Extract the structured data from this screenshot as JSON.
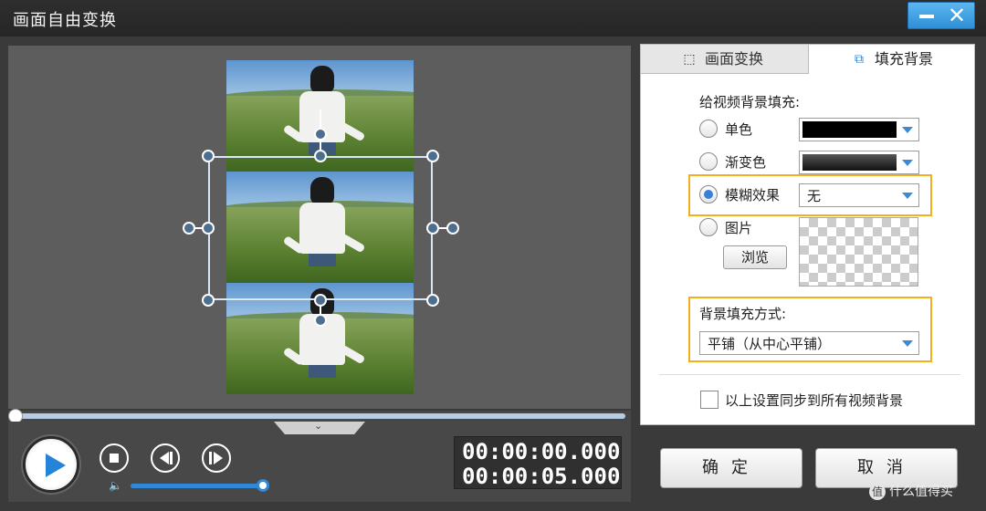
{
  "window": {
    "title": "画面自由变换",
    "minimize_icon": "minimize-icon",
    "close_glyph": "✕"
  },
  "preview": {
    "collapse_glyph": "⌄"
  },
  "playback": {
    "current_time": "00:00:00.000",
    "total_time": "00:00:05.000",
    "progress": 0.0,
    "volume": 1.0
  },
  "tabs": [
    {
      "label": "画面变换",
      "icon": "transform-icon",
      "glyph": "⬚",
      "active": false
    },
    {
      "label": "填充背景",
      "icon": "fill-background-icon",
      "glyph": "⧉",
      "active": true
    }
  ],
  "fill": {
    "section_title": "给视频背景填充:",
    "options": [
      {
        "label": "单色",
        "selected": false
      },
      {
        "label": "渐变色",
        "selected": false
      },
      {
        "label": "模糊效果",
        "selected": true
      },
      {
        "label": "图片",
        "selected": false
      }
    ],
    "solid_color": "#000000",
    "gradient_colors": [
      "#555555",
      "#111111"
    ],
    "blur_value": "无",
    "browse_label": "浏览"
  },
  "fill_mode": {
    "title": "背景填充方式:",
    "value": "平铺（从中心平铺）"
  },
  "sync": {
    "label": "以上设置同步到所有视频背景",
    "checked": false
  },
  "buttons": {
    "ok": "确定",
    "cancel": "取消"
  },
  "watermark": {
    "glyph": "值",
    "text": "什么值得买"
  },
  "colors": {
    "accent": "#2f88d8",
    "highlight": "#f2b01e"
  }
}
